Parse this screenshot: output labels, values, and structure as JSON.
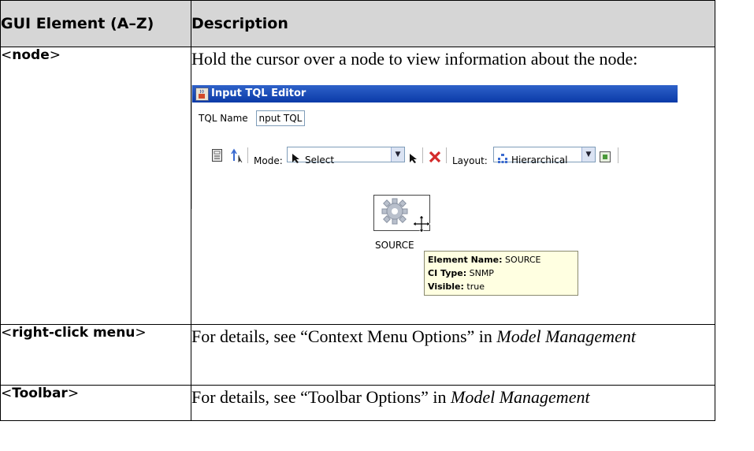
{
  "table": {
    "header": {
      "col1": "GUI Element (A–Z)",
      "col2": "Description"
    },
    "rows": [
      {
        "element_open": "<",
        "element": "node",
        "element_close": ">",
        "description": "Hold the cursor over a node to view information about the node:"
      },
      {
        "element_open": "<",
        "element": "right-click menu",
        "element_close": ">",
        "description_prefix": "For details, see “Context Menu Options” in ",
        "description_ref": "Model Management"
      },
      {
        "element_open": "<",
        "element": "Toolbar",
        "element_close": ">",
        "description_prefix": "For details, see “Toolbar Options” in ",
        "description_ref": "Model Management"
      }
    ]
  },
  "screenshot": {
    "window_title": "Input TQL Editor",
    "tql_name_label": "TQL Name",
    "tql_name_value": "nput TQL",
    "toolbar": {
      "mode_label": "Mode:",
      "mode_value": "Select",
      "layout_label": "Layout:",
      "layout_value": "Hierarchical"
    },
    "node_label": "SOURCE",
    "tooltip": {
      "name_label": "Element Name:",
      "name_value": "SOURCE",
      "type_label": "CI Type:",
      "type_value": "SNMP",
      "visible_label": "Visible:",
      "visible_value": "true"
    },
    "icons": [
      "java-cup-icon",
      "calculator-icon",
      "move-up-icon",
      "cursor-arrow-icon",
      "pointer-icon",
      "delete-x-icon",
      "hierarchical-layout-icon",
      "fit-to-window-icon",
      "gear-node-icon",
      "move-cursor-icon"
    ],
    "colors": {
      "header_bg": "#d6d6d6",
      "titlebar": "#0a3aa8",
      "tooltip_bg": "#ffffe1",
      "delete_red": "#d42a2a"
    }
  }
}
